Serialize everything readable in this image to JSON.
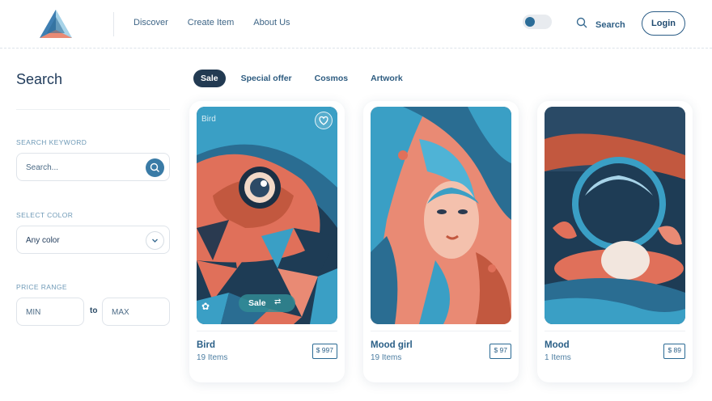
{
  "header": {
    "nav": [
      "Discover",
      "Create Item",
      "About Us"
    ],
    "search_label": "Search",
    "login_label": "Login"
  },
  "sidebar": {
    "title": "Search",
    "keyword_label": "SEARCH KEYWORD",
    "keyword_placeholder": "Search...",
    "color_label": "SELECT COLOR",
    "color_value": "Any color",
    "price_label": "PRICE RANGE",
    "min_placeholder": "MIN",
    "to_text": "to",
    "max_placeholder": "MAX"
  },
  "tabs": [
    "Sale",
    "Special offer",
    "Cosmos",
    "Artwork"
  ],
  "cards": [
    {
      "title": "Bird",
      "count": "19 Items",
      "price": "$ 997",
      "corner_label": "Bird",
      "badge": "Sale"
    },
    {
      "title": "Mood girl",
      "count": "19 Items",
      "price": "$ 97"
    },
    {
      "title": "Mood",
      "count": "1 Items",
      "price": "$ 89"
    }
  ],
  "colors": {
    "primary": "#1f3a5a",
    "accent": "#3a7ba6",
    "active_tab": "#223a52",
    "coral": "#e0705a",
    "teal": "#3a9fc5"
  },
  "icons": {
    "logo": "triangle-logo-icon",
    "search": "search-icon",
    "chevron": "chevron-down-icon",
    "heart": "heart-icon",
    "arrow": "arrows-icon"
  }
}
